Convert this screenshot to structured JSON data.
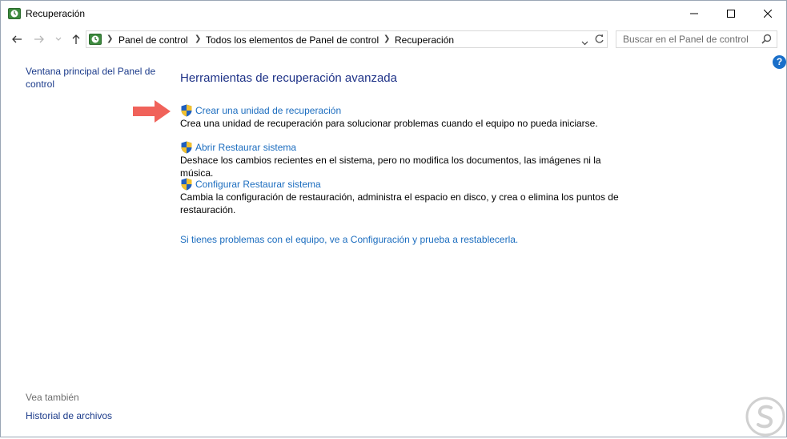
{
  "window": {
    "title": "Recuperación"
  },
  "address": {
    "breadcrumbs": [
      "Panel de control",
      "Todos los elementos de Panel de control",
      "Recuperación"
    ]
  },
  "search": {
    "placeholder": "Buscar en el Panel de control"
  },
  "help": {
    "label": "?"
  },
  "left_pane": {
    "main_link": "Ventana principal del Panel de control",
    "see_also": "Vea también",
    "history": "Historial de archivos"
  },
  "main": {
    "heading": "Herramientas de recuperación avanzada",
    "items": [
      {
        "link": "Crear una unidad de recuperación",
        "desc": "Crea una unidad de recuperación para solucionar problemas cuando el equipo no pueda iniciarse."
      },
      {
        "link": "Abrir Restaurar sistema",
        "desc": "Deshace los cambios recientes en el sistema, pero no modifica los documentos, las imágenes ni la música."
      },
      {
        "link": "Configurar Restaurar sistema",
        "desc": "Cambia la configuración de restauración, administra el espacio en disco, y crea o elimina los puntos de restauración."
      }
    ],
    "bottom_link": "Si tienes problemas con el equipo, ve a Configuración y prueba a restablecerla."
  },
  "icons": [
    "recovery-app-icon",
    "back-arrow-icon",
    "forward-arrow-icon",
    "recent-dropdown-icon",
    "up-arrow-icon",
    "shield-icon",
    "search-icon",
    "refresh-icon",
    "red-arrow-icon",
    "watermark-logo-icon"
  ],
  "colors": {
    "link": "#1c6dbf",
    "heading": "#1e3287",
    "arrow": "#f0625a"
  }
}
